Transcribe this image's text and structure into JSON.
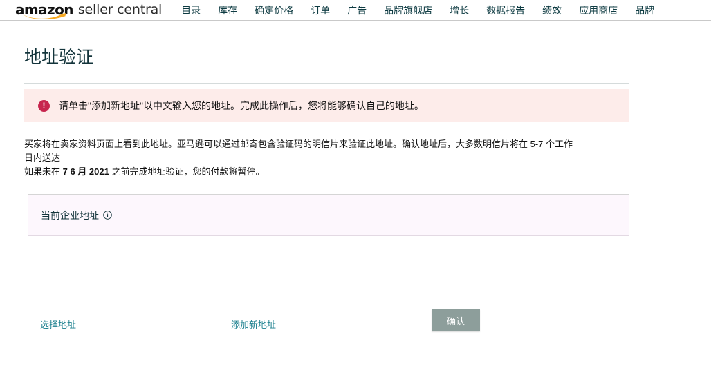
{
  "nav": {
    "brand": {
      "amazon": "amazon",
      "seller_central": "seller central",
      "smile_color": "#f6a821"
    },
    "items": [
      {
        "label": "目录"
      },
      {
        "label": "库存"
      },
      {
        "label": "确定价格"
      },
      {
        "label": "订单"
      },
      {
        "label": "广告"
      },
      {
        "label": "品牌旗舰店"
      },
      {
        "label": "增长"
      },
      {
        "label": "数据报告"
      },
      {
        "label": "绩效"
      },
      {
        "label": "应用商店"
      },
      {
        "label": "品牌"
      }
    ]
  },
  "page": {
    "title": "地址验证"
  },
  "alert": {
    "icon": "error-exclamation-icon",
    "icon_glyph": "!",
    "background_color": "#fdecea",
    "icon_color": "#c7254e",
    "message": "请单击\"添加新地址\"以中文输入您的地址。完成此操作后，您将能够确认自己的地址。"
  },
  "intro": {
    "line1": "买家将在卖家资料页面上看到此地址。亚马逊可以通过邮寄包含验证码的明信片来验证此地址。确认地址后，大多数明信片将在 5-7 个工作日内送达",
    "line2_before": "如果未在 ",
    "line2_date": "7 6 月 2021",
    "line2_after": " 之前完成地址验证，您的付款将暂停。"
  },
  "card": {
    "header_title": "当前企业地址",
    "info_icon": "info-circle-icon",
    "header_background": "#fdf7fd",
    "links": {
      "select_address": "选择地址",
      "add_new_address": "添加新地址"
    },
    "confirm_button": {
      "label": "确认",
      "background_color": "#8d9e9b",
      "text_color": "#ffffff"
    }
  }
}
